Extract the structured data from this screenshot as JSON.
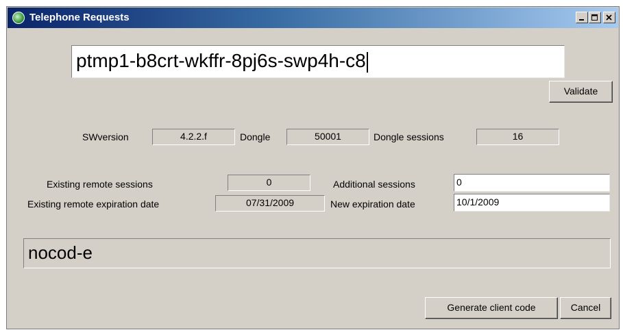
{
  "window": {
    "title": "Telephone Requests"
  },
  "code_input": {
    "value": "ptmp1-b8crt-wkffr-8pj6s-swp4h-c8"
  },
  "buttons": {
    "validate": "Validate",
    "generate": "Generate client code",
    "cancel": "Cancel"
  },
  "info": {
    "swversion_label": "SWversion",
    "swversion_value": "4.2.2.f",
    "dongle_label": "Dongle",
    "dongle_value": "50001",
    "dongle_sessions_label": "Dongle sessions",
    "dongle_sessions_value": "16"
  },
  "remote": {
    "existing_sessions_label": "Existing remote sessions",
    "existing_sessions_value": "0",
    "existing_expiration_label": "Existing remote expiration date",
    "existing_expiration_value": "07/31/2009",
    "additional_sessions_label": "Additional sessions",
    "additional_sessions_value": "0",
    "new_expiration_label": "New expiration date",
    "new_expiration_value": "10/1/2009"
  },
  "result": {
    "value": "nocod-e"
  }
}
